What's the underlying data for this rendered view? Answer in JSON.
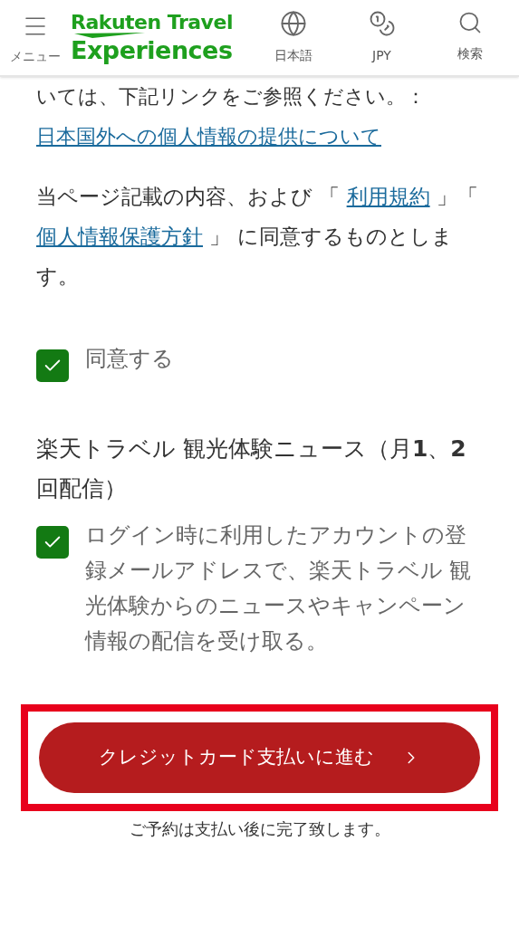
{
  "header": {
    "menu_label": "メニュー",
    "logo_lines": [
      "Rakuten Travel",
      "Experiences"
    ],
    "actions": [
      {
        "kind": "language",
        "label": "日本語"
      },
      {
        "kind": "currency",
        "label": "JPY"
      },
      {
        "kind": "search",
        "label": "検索"
      }
    ]
  },
  "notice": {
    "text": "いては、下記リンクをご参照ください。：",
    "link": "日本国外への個人情報の提供について"
  },
  "agreement": {
    "segments": [
      {
        "kind": "text",
        "text": "当ページ記載の内容、および 「 "
      },
      {
        "kind": "link",
        "text": "利用規約"
      },
      {
        "kind": "text",
        "text": " 」「 "
      },
      {
        "kind": "link",
        "text": "個人情報保護方針"
      },
      {
        "kind": "text",
        "text": " 」 に同意するものとします。"
      }
    ],
    "checkbox": {
      "label": "同意する",
      "checked": true
    }
  },
  "newsletter": {
    "title": "楽天トラベル 観光体験ニュース（月**1**、**2**回配信）",
    "checkbox": {
      "label": "ログイン時に利用したアカウントの登録メールアドレスで、楽天トラベル 観光体験からのニュースやキャンペーン情報の配信を受け取る。",
      "checked": true
    }
  },
  "submit": {
    "label": "クレジットカード支払いに進む",
    "highlighted": true,
    "note": "ご予約は支払い後に完了致します。"
  }
}
